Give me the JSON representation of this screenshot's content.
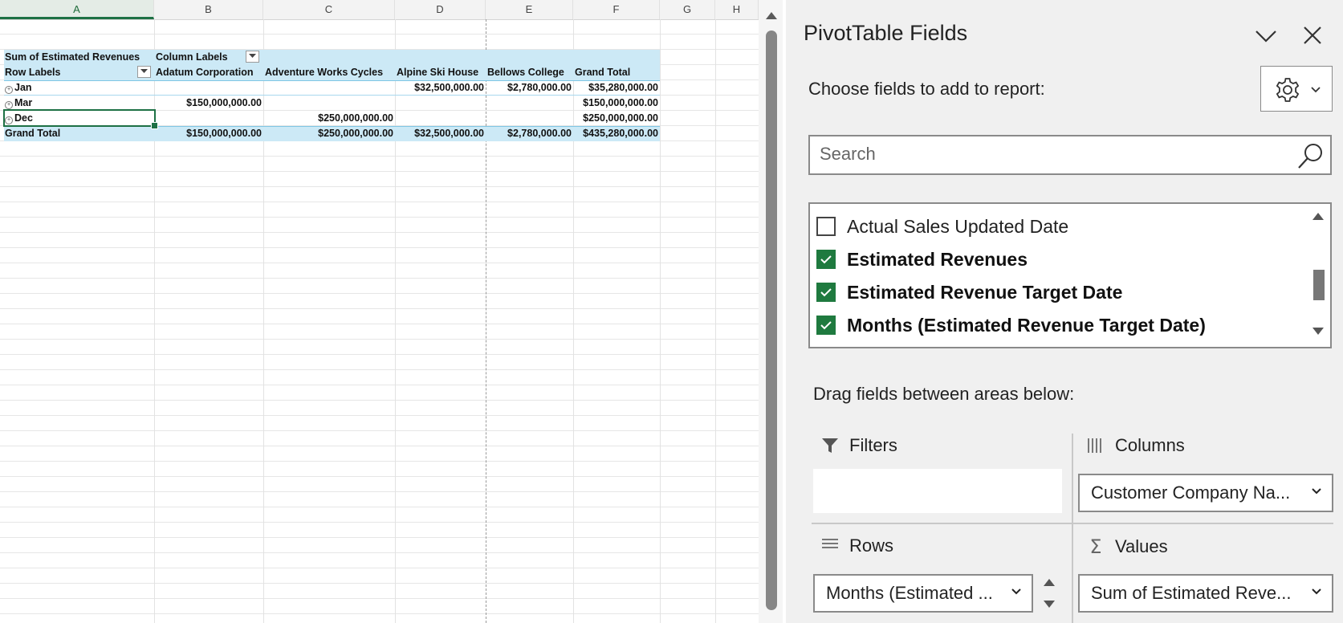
{
  "sheet": {
    "columns": [
      "A",
      "B",
      "C",
      "D",
      "E",
      "F",
      "G",
      "H"
    ],
    "pivot": {
      "corner_label": "Sum of Estimated Revenues",
      "column_labels": "Column Labels",
      "row_labels": "Row Labels",
      "headers": [
        "Adatum Corporation",
        "Adventure Works Cycles",
        "Alpine Ski House",
        "Bellows College",
        "Grand Total"
      ],
      "rows": [
        {
          "label": "Jan",
          "values": [
            "",
            "",
            "$32,500,000.00",
            "$2,780,000.00",
            "$35,280,000.00"
          ]
        },
        {
          "label": "Mar",
          "values": [
            "$150,000,000.00",
            "",
            "",
            "",
            "$150,000,000.00"
          ]
        },
        {
          "label": "Dec",
          "values": [
            "",
            "$250,000,000.00",
            "",
            "",
            "$250,000,000.00"
          ]
        }
      ],
      "grand_total": {
        "label": "Grand Total",
        "values": [
          "$150,000,000.00",
          "$250,000,000.00",
          "$32,500,000.00",
          "$2,780,000.00",
          "$435,280,000.00"
        ]
      }
    }
  },
  "pane": {
    "title": "PivotTable Fields",
    "choose_label": "Choose fields to add to report:",
    "search_placeholder": "Search",
    "fields": [
      {
        "label": "Actual Sales Updated Date",
        "checked": false
      },
      {
        "label": "Estimated Revenues",
        "checked": true
      },
      {
        "label": "Estimated Revenue Target Date",
        "checked": true
      },
      {
        "label": "Months (Estimated Revenue Target Date)",
        "checked": true
      }
    ],
    "drag_label": "Drag fields between areas below:",
    "areas": {
      "filters": {
        "label": "Filters"
      },
      "columns": {
        "label": "Columns",
        "item": "Customer Company Na..."
      },
      "rows": {
        "label": "Rows",
        "item": "Months (Estimated ..."
      },
      "values": {
        "label": "Values",
        "item": "Sum of Estimated Reve..."
      }
    }
  },
  "colors": {
    "accent_green": "#1f7a3f",
    "pivot_band": "#cce9f6"
  }
}
